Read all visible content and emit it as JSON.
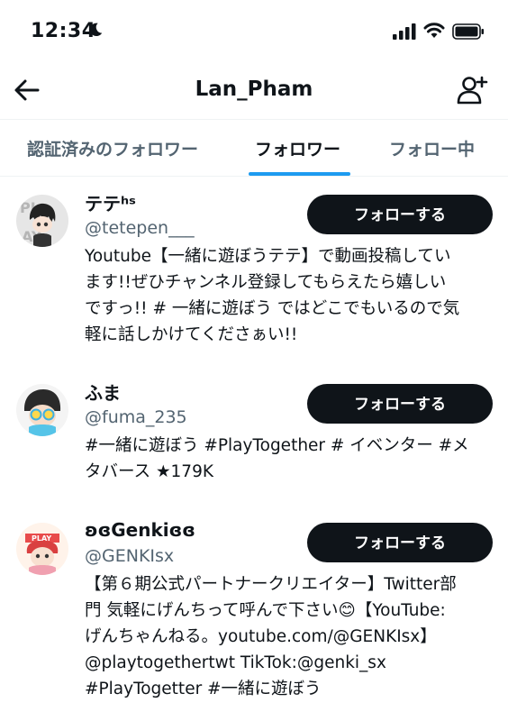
{
  "status": {
    "time": "12:34"
  },
  "header": {
    "title": "Lan_Pham"
  },
  "tabs": [
    {
      "label": "認証済みのフォロワー"
    },
    {
      "label": "フォロワー"
    },
    {
      "label": "フォロー中"
    }
  ],
  "users": [
    {
      "name": "テテʰˢ",
      "handle": "@tetepen___",
      "button": "フォローする",
      "bio": [
        "Youtube【一緒に遊ぼうテテ】で動画投稿してい",
        "ます!!ぜひチャンネル登録してもらえたら嬉しい",
        "ですっ!! # 一緒に遊ぼう ではどこでもいるので気",
        "軽に話しかけてくださぁい!!"
      ]
    },
    {
      "name": "ふま",
      "handle": "@fuma_235",
      "button": "フォローする",
      "bio": [
        "#一緒に遊ぼう #PlayTogether # イベンター #メ",
        "タバース ★179K"
      ]
    },
    {
      "name": "ʚɞGenkiɞɞ",
      "handle": "@GENKIsx",
      "button": "フォローする",
      "bio": [
        "【第６期公式パートナークリエイター】Twitter部",
        "門 気軽にげんちって呼んで下さい😊【YouTube:",
        "げんちゃんねる。youtube.com/@GENKIsx】",
        "@playtogethertwt TikTok:@genki_sx",
        "#PlayTogetter #一緒に遊ぼう"
      ]
    }
  ]
}
